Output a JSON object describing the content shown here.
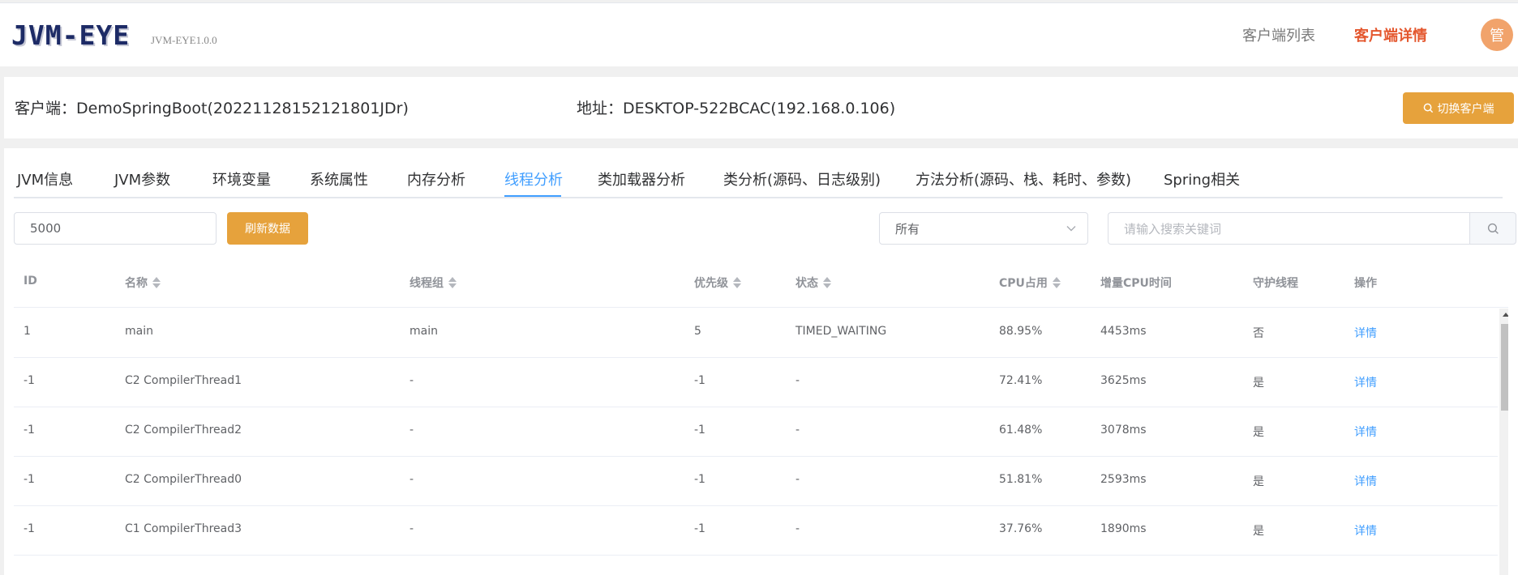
{
  "header": {
    "logo": "JVM-EYE",
    "version": "JVM-EYE1.0.0",
    "nav_list": "客户端列表",
    "nav_detail": "客户端详情",
    "avatar": "管"
  },
  "client": {
    "label": "客户端：DemoSpringBoot(20221128152121801JDr)",
    "address": "地址：DESKTOP-522BCAC(192.168.0.106)",
    "switch_button": "切换客户端"
  },
  "tabs": [
    {
      "label": "JVM信息"
    },
    {
      "label": "JVM参数"
    },
    {
      "label": "环境变量"
    },
    {
      "label": "系统属性"
    },
    {
      "label": "内存分析"
    },
    {
      "label": "线程分析",
      "active": true
    },
    {
      "label": "类加载器分析"
    },
    {
      "label": "类分析(源码、日志级别)"
    },
    {
      "label": "方法分析(源码、栈、耗时、参数)"
    },
    {
      "label": "Spring相关"
    }
  ],
  "toolbar": {
    "interval_value": "5000",
    "refresh_button": "刷新数据",
    "state_selected": "所有",
    "search_placeholder": "请输入搜索关键词"
  },
  "table": {
    "headers": {
      "id": "ID",
      "name": "名称",
      "group": "线程组",
      "priority": "优先级",
      "state": "状态",
      "cpu": "CPU占用",
      "delta_cpu": "增量CPU时间",
      "daemon": "守护线程",
      "action": "操作"
    },
    "rows": [
      {
        "id": "1",
        "name": "main",
        "group": "main",
        "priority": "5",
        "state": "TIMED_WAITING",
        "cpu": "88.95%",
        "delta_cpu": "4453ms",
        "daemon": "否",
        "action": "详情"
      },
      {
        "id": "-1",
        "name": "C2 CompilerThread1",
        "group": "-",
        "priority": "-1",
        "state": "-",
        "cpu": "72.41%",
        "delta_cpu": "3625ms",
        "daemon": "是",
        "action": "详情"
      },
      {
        "id": "-1",
        "name": "C2 CompilerThread2",
        "group": "-",
        "priority": "-1",
        "state": "-",
        "cpu": "61.48%",
        "delta_cpu": "3078ms",
        "daemon": "是",
        "action": "详情"
      },
      {
        "id": "-1",
        "name": "C2 CompilerThread0",
        "group": "-",
        "priority": "-1",
        "state": "-",
        "cpu": "51.81%",
        "delta_cpu": "2593ms",
        "daemon": "是",
        "action": "详情"
      },
      {
        "id": "-1",
        "name": "C1 CompilerThread3",
        "group": "-",
        "priority": "-1",
        "state": "-",
        "cpu": "37.76%",
        "delta_cpu": "1890ms",
        "daemon": "是",
        "action": "详情"
      }
    ]
  },
  "colors": {
    "accent": "#409eff",
    "warning": "#e6a23c",
    "active_nav": "#e4572e"
  }
}
